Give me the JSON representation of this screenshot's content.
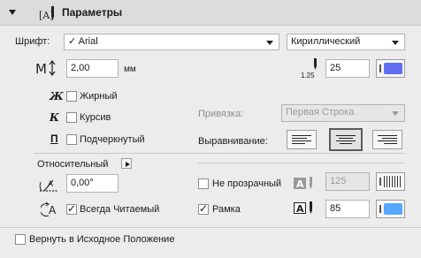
{
  "header": {
    "title": "Параметры"
  },
  "font": {
    "label": "Шрифт:",
    "value": "Arial",
    "check": "✓",
    "charset": "Кириллический"
  },
  "size": {
    "value": "2,00",
    "unit": "мм"
  },
  "pen": {
    "value": "25",
    "weight_label": "1.25",
    "color": "#5d6ff0"
  },
  "styles": {
    "bold": {
      "glyph": "Ж",
      "label": "Жирный",
      "checked": false
    },
    "italic": {
      "glyph": "К",
      "label": "Курсив",
      "checked": false
    },
    "underline": {
      "glyph": "П",
      "label": "Подчеркнутый",
      "checked": false
    }
  },
  "anchor": {
    "label": "Привязка:",
    "value": "Первая Строка"
  },
  "alignment": {
    "label": "Выравнивание:",
    "options": [
      "left",
      "center",
      "right"
    ],
    "selected": "center"
  },
  "relative": {
    "label": "Относительный"
  },
  "angle": {
    "value": "0,00°"
  },
  "opaque": {
    "label": "Не прозрачный",
    "checked": false,
    "value": "125"
  },
  "readable": {
    "label": "Всегда Читаемый",
    "checked": true
  },
  "frame": {
    "label": "Рамка",
    "checked": true,
    "value": "85",
    "color": "#55a8ff"
  },
  "reset": {
    "label": "Вернуть в Исходное Положение",
    "checked": false
  }
}
